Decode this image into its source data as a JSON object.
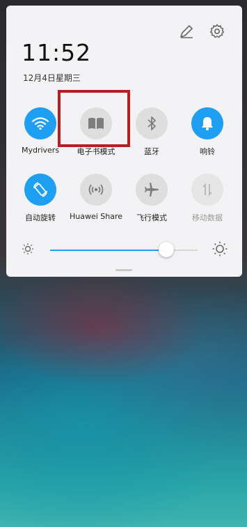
{
  "status": {
    "time": "11:52",
    "date": "12月4日星期三"
  },
  "header": {
    "edit_icon": "pencil-icon",
    "settings_icon": "gear-icon"
  },
  "tiles": [
    {
      "label": "Mydrivers",
      "icon": "wifi-icon",
      "on": true
    },
    {
      "label": "电子书模式",
      "icon": "book-icon",
      "on": false
    },
    {
      "label": "蓝牙",
      "icon": "bluetooth-icon",
      "on": false
    },
    {
      "label": "响铃",
      "icon": "bell-icon",
      "on": true
    },
    {
      "label": "自动旋转",
      "icon": "rotate-icon",
      "on": true
    },
    {
      "label": "Huawei Share",
      "icon": "share-signal-icon",
      "on": false
    },
    {
      "label": "飞行模式",
      "icon": "airplane-icon",
      "on": false
    },
    {
      "label": "移动数据",
      "icon": "mobile-data-icon",
      "on": false,
      "disabled": true
    }
  ],
  "brightness": {
    "level": 0.79
  },
  "colors": {
    "accent": "#1e9ff2",
    "highlight": "#b41f1f"
  }
}
